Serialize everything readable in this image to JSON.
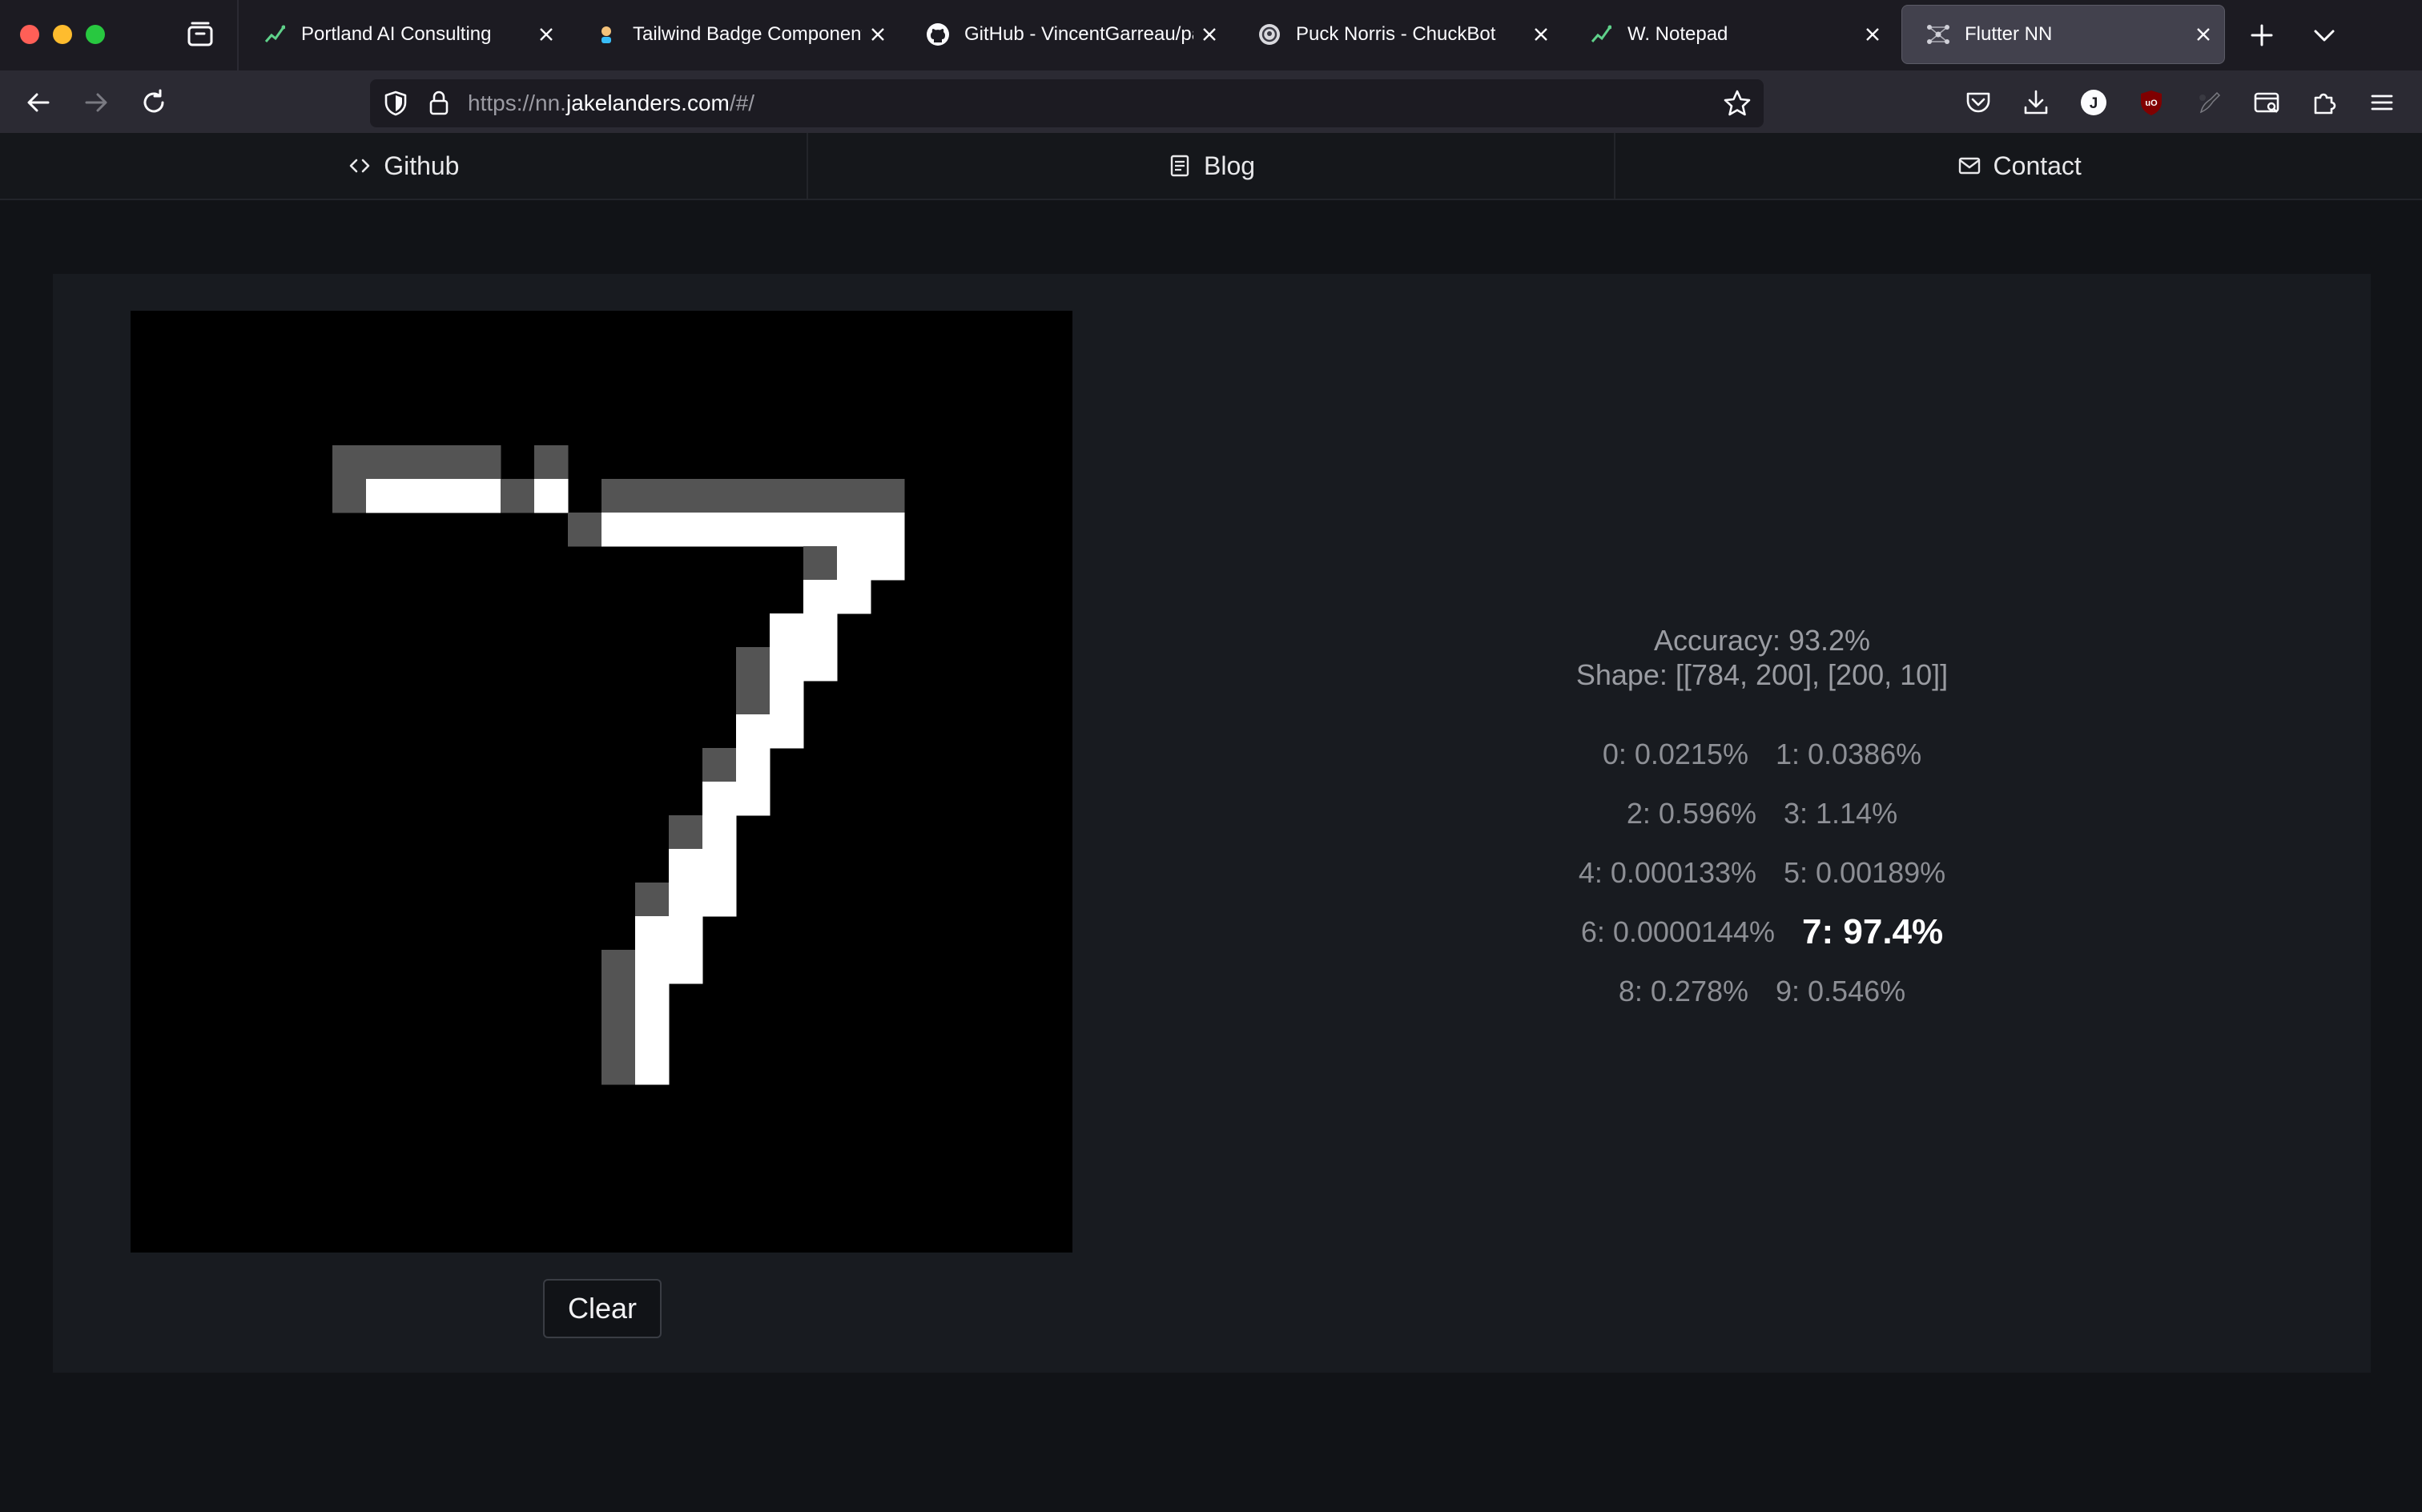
{
  "browser": {
    "tabs": [
      {
        "title": "Portland AI Consulting",
        "icon": "chart-favicon-icon",
        "active": false
      },
      {
        "title": "Tailwind Badge Component -",
        "icon": "tailwind-favicon-icon",
        "active": false
      },
      {
        "title": "GitHub - VincentGarreau/par",
        "icon": "github-favicon-icon",
        "active": false
      },
      {
        "title": "Puck Norris - ChuckBot",
        "icon": "chuckbot-favicon-icon",
        "active": false
      },
      {
        "title": "W. Notepad",
        "icon": "chart-favicon-icon",
        "active": false
      },
      {
        "title": "Flutter NN",
        "icon": "network-favicon-icon",
        "active": true
      }
    ],
    "url_prefix": "https://nn.",
    "url_host": "jakelanders.com",
    "url_path": "/#/",
    "accent": "#fbfbfe"
  },
  "nav": {
    "github": "Github",
    "blog": "Blog",
    "contact": "Contact"
  },
  "drawing": {
    "grid_size": 28,
    "digit": "7",
    "pixels": [
      [
        4,
        6,
        0.33
      ],
      [
        4,
        7,
        0.33
      ],
      [
        4,
        8,
        0.33
      ],
      [
        4,
        9,
        0.33
      ],
      [
        4,
        10,
        0.33
      ],
      [
        4,
        12,
        0.33
      ],
      [
        5,
        6,
        0.33
      ],
      [
        5,
        7,
        1
      ],
      [
        5,
        8,
        1
      ],
      [
        5,
        9,
        1
      ],
      [
        5,
        10,
        1
      ],
      [
        5,
        11,
        0.33
      ],
      [
        5,
        12,
        1
      ],
      [
        5,
        14,
        0.33
      ],
      [
        5,
        15,
        0.33
      ],
      [
        5,
        16,
        0.33
      ],
      [
        5,
        17,
        0.33
      ],
      [
        5,
        18,
        0.33
      ],
      [
        5,
        19,
        0.33
      ],
      [
        5,
        20,
        0.33
      ],
      [
        5,
        21,
        0.33
      ],
      [
        5,
        22,
        0.33
      ],
      [
        6,
        13,
        0.33
      ],
      [
        6,
        14,
        1
      ],
      [
        6,
        15,
        1
      ],
      [
        6,
        16,
        1
      ],
      [
        6,
        17,
        1
      ],
      [
        6,
        18,
        1
      ],
      [
        6,
        19,
        1
      ],
      [
        6,
        20,
        1
      ],
      [
        6,
        21,
        1
      ],
      [
        6,
        22,
        1
      ],
      [
        7,
        20,
        0.33
      ],
      [
        7,
        21,
        1
      ],
      [
        7,
        22,
        1
      ],
      [
        8,
        20,
        1
      ],
      [
        8,
        21,
        1
      ],
      [
        9,
        19,
        1
      ],
      [
        9,
        20,
        1
      ],
      [
        10,
        18,
        0.33
      ],
      [
        10,
        19,
        1
      ],
      [
        10,
        20,
        1
      ],
      [
        11,
        18,
        0.33
      ],
      [
        11,
        19,
        1
      ],
      [
        12,
        18,
        1
      ],
      [
        12,
        19,
        1
      ],
      [
        13,
        17,
        0.33
      ],
      [
        13,
        18,
        1
      ],
      [
        14,
        17,
        1
      ],
      [
        14,
        18,
        1
      ],
      [
        15,
        16,
        0.33
      ],
      [
        15,
        17,
        1
      ],
      [
        16,
        16,
        1
      ],
      [
        16,
        17,
        1
      ],
      [
        17,
        15,
        0.33
      ],
      [
        17,
        16,
        1
      ],
      [
        17,
        17,
        1
      ],
      [
        18,
        15,
        1
      ],
      [
        18,
        16,
        1
      ],
      [
        19,
        14,
        0.33
      ],
      [
        19,
        15,
        1
      ],
      [
        19,
        16,
        1
      ],
      [
        20,
        14,
        0.33
      ],
      [
        20,
        15,
        1
      ],
      [
        21,
        14,
        0.33
      ],
      [
        21,
        15,
        1
      ],
      [
        22,
        14,
        0.33
      ],
      [
        22,
        15,
        1
      ]
    ]
  },
  "clear_label": "Clear",
  "stats": {
    "accuracy": "Accuracy: 93.2%",
    "shape": "Shape: [[784, 200], [200, 10]]"
  },
  "predictions": [
    {
      "label": "0: 0.0215%",
      "value": 0.000215
    },
    {
      "label": "1: 0.0386%",
      "value": 0.000386
    },
    {
      "label": "2: 0.596%",
      "value": 0.00596
    },
    {
      "label": "3: 1.14%",
      "value": 0.0114
    },
    {
      "label": "4: 0.000133%",
      "value": 1.33e-06
    },
    {
      "label": "5: 0.00189%",
      "value": 1.89e-05
    },
    {
      "label": "6: 0.0000144%",
      "value": 1.44e-07
    },
    {
      "label": "7: 97.4%",
      "value": 0.974,
      "best": true
    },
    {
      "label": "8: 0.278%",
      "value": 0.00278
    },
    {
      "label": "9: 0.546%",
      "value": 0.00546
    }
  ]
}
